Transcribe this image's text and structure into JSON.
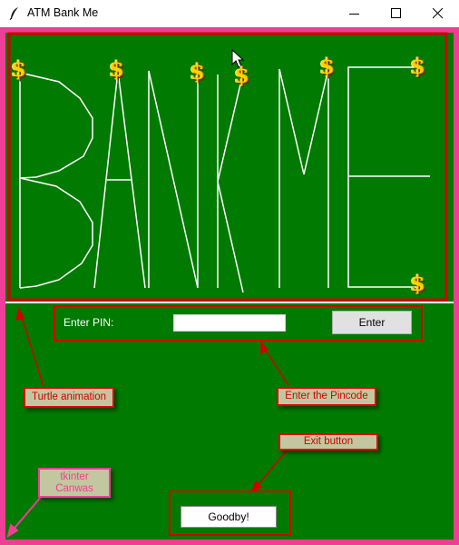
{
  "window": {
    "title": "ATM Bank Me",
    "controls": [
      "minimize-icon",
      "maximize-icon",
      "close-icon"
    ]
  },
  "canvas": {
    "background_color": "#007a00",
    "frame_color": "#ef3e96",
    "drawing_color": "#ffffff",
    "dollar_symbol": "$",
    "dollar_count": 8
  },
  "pin_form": {
    "label": "Enter PIN:",
    "input_value": "",
    "enter_label": "Enter"
  },
  "exit": {
    "label": "Goodby!"
  },
  "annotations": {
    "turtle": "Turtle animation",
    "pincode": "Enter the Pincode",
    "exit_button": "Exit button",
    "canvas_line1": "tkinter",
    "canvas_line2": "Canwas",
    "annotation_color": "#e10000"
  }
}
